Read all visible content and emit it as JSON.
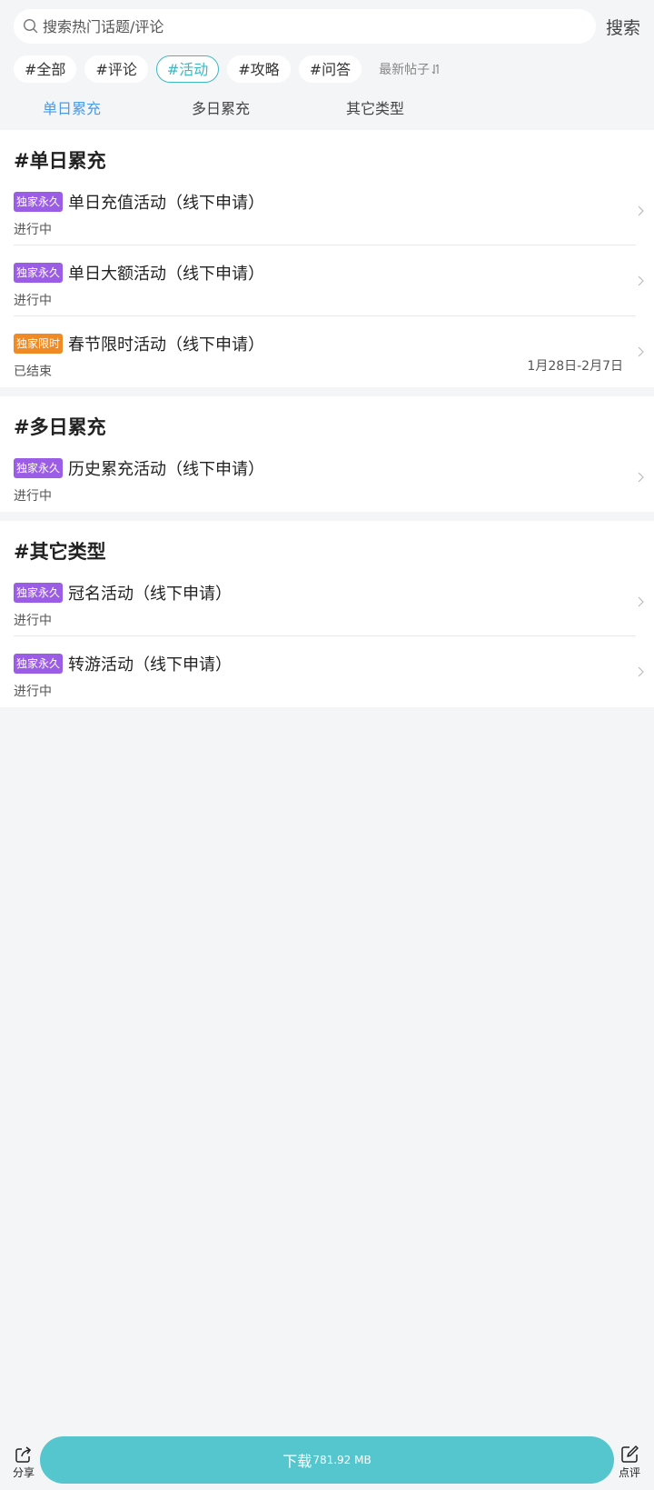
{
  "search": {
    "placeholder": "搜索热门话题/评论",
    "button_label": "搜索"
  },
  "tags": [
    {
      "label": "#全部",
      "active": false
    },
    {
      "label": "#评论",
      "active": false
    },
    {
      "label": "#活动",
      "active": true
    },
    {
      "label": "#攻略",
      "active": false
    },
    {
      "label": "#问答",
      "active": false
    }
  ],
  "sort_label": "最新帖子",
  "subtabs": [
    {
      "label": "单日累充",
      "active": true
    },
    {
      "label": "多日累充",
      "active": false
    },
    {
      "label": "其它类型",
      "active": false
    }
  ],
  "sections": [
    {
      "title": "#单日累充",
      "items": [
        {
          "badge": "独家永久",
          "badge_color": "#9b5de5",
          "title": "单日充值活动（线下申请）",
          "status": "进行中",
          "date": ""
        },
        {
          "badge": "独家永久",
          "badge_color": "#9b5de5",
          "title": "单日大额活动（线下申请）",
          "status": "进行中",
          "date": ""
        },
        {
          "badge": "独家限时",
          "badge_color": "#f08a24",
          "title": "春节限时活动（线下申请）",
          "status": "已结束",
          "date": "1月28日-2月7日"
        }
      ]
    },
    {
      "title": "#多日累充",
      "items": [
        {
          "badge": "独家永久",
          "badge_color": "#9b5de5",
          "title": "历史累充活动（线下申请）",
          "status": "进行中",
          "date": ""
        }
      ]
    },
    {
      "title": "#其它类型",
      "items": [
        {
          "badge": "独家永久",
          "badge_color": "#9b5de5",
          "title": "冠名活动（线下申请）",
          "status": "进行中",
          "date": ""
        },
        {
          "badge": "独家永久",
          "badge_color": "#9b5de5",
          "title": "转游活动（线下申请）",
          "status": "进行中",
          "date": ""
        }
      ]
    }
  ],
  "bottom": {
    "share_label": "分享",
    "download_label": "下载",
    "download_size": "781.92 MB",
    "review_label": "点评",
    "accent_color": "#55c6ce"
  }
}
